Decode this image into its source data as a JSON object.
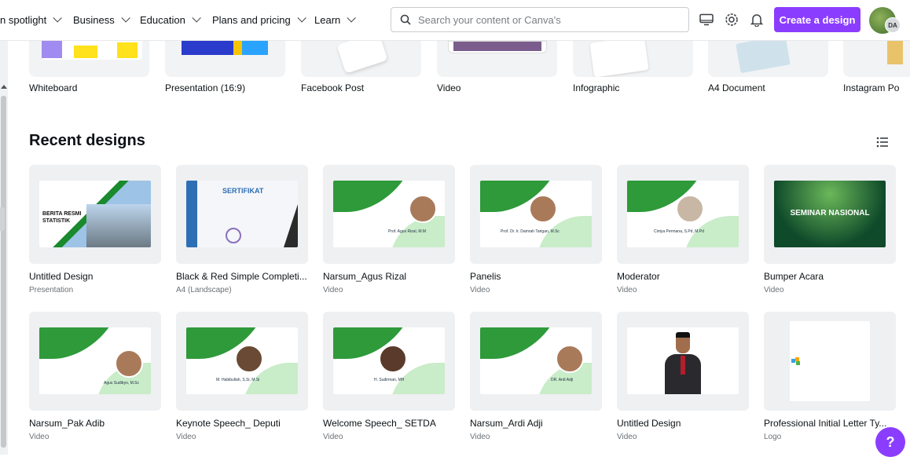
{
  "nav": {
    "items": [
      {
        "label": "n spotlight"
      },
      {
        "label": "Business"
      },
      {
        "label": "Education"
      },
      {
        "label": "Plans and pricing"
      },
      {
        "label": "Learn"
      }
    ],
    "search_placeholder": "Search your content or Canva's",
    "create_label": "Create a design",
    "avatar_initials": "DA"
  },
  "templates": [
    {
      "label": "Whiteboard"
    },
    {
      "label": "Presentation (16:9)"
    },
    {
      "label": "Facebook Post"
    },
    {
      "label": "Video"
    },
    {
      "label": "Infographic"
    },
    {
      "label": "A4 Document"
    },
    {
      "label": "Instagram Po"
    }
  ],
  "recent": {
    "title": "Recent designs",
    "row1": [
      {
        "title": "Untitled Design",
        "type": "Presentation",
        "thumb_text": "BERITA RESMI\nSTATISTIK"
      },
      {
        "title": "Black & Red Simple Completi...",
        "type": "A4 (Landscape)",
        "thumb_text": "SERTIFIKAT"
      },
      {
        "title": "Narsum_Agus Rizal",
        "type": "Video",
        "thumb_text": "Prof. Agus Rizal, M.M"
      },
      {
        "title": "Panelis",
        "type": "Video",
        "thumb_text": "Prof. Dr. Ir. Damrah Tarigan, M.Sc"
      },
      {
        "title": "Moderator",
        "type": "Video",
        "thumb_text": "Cintya Permana, S.Pd, M.Pd"
      },
      {
        "title": "Bumper Acara",
        "type": "Video",
        "thumb_text": "SEMINAR NASIONAL"
      }
    ],
    "row2": [
      {
        "title": "Narsum_Pak Adib",
        "type": "Video",
        "thumb_text": "Agus Sudibyo, M.Sc"
      },
      {
        "title": "Keynote Speech_ Deputi",
        "type": "Video",
        "thumb_text": "M. Habibullah, S.Si, M.Si"
      },
      {
        "title": "Welcome Speech_ SETDA",
        "type": "Video",
        "thumb_text": "H. Sudirman, MH"
      },
      {
        "title": "Narsum_Ardi Adji",
        "type": "Video",
        "thumb_text": "DR. Ardi Adji"
      },
      {
        "title": "Untitled Design",
        "type": "Video",
        "thumb_text": ""
      },
      {
        "title": "Professional Initial Letter Ty...",
        "type": "Logo",
        "thumb_text": ""
      }
    ]
  },
  "help_label": "?",
  "colors": {
    "brand": "#8b3dff",
    "green": "#2e9a3a"
  }
}
